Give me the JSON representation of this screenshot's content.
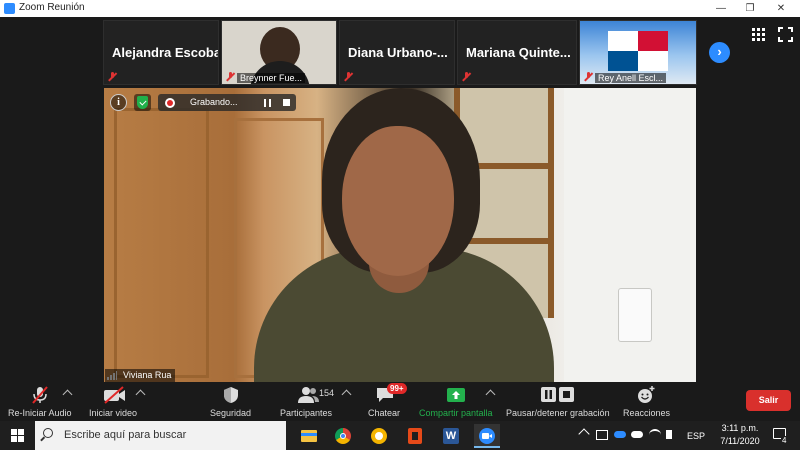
{
  "window": {
    "title": "Zoom Reunión",
    "controls": [
      "—",
      "❐",
      "✕"
    ]
  },
  "gallery": {
    "tiles": [
      {
        "name": "Alejandra Escobar",
        "type": "name"
      },
      {
        "name": "Breynner Fue...",
        "type": "video"
      },
      {
        "name": "Diana Urbano-...",
        "type": "name"
      },
      {
        "name": "Mariana Quinte...",
        "type": "name"
      },
      {
        "name": "Rey Anell Escl...",
        "type": "video"
      }
    ],
    "next_icon": "chevron-right-icon"
  },
  "meeting": {
    "recording_label": "Grabando...",
    "speaker_name": "Viviana Rua"
  },
  "toolbar": {
    "audio_label": "Re-Iniciar Audio",
    "video_label": "Iniciar video",
    "security_label": "Seguridad",
    "participants_label": "Participantes",
    "participants_count": "154",
    "chat_label": "Chatear",
    "chat_badge": "99+",
    "share_label": "Compartir pantalla",
    "record_label": "Pausar/detener grabación",
    "reactions_label": "Reacciones",
    "leave_label": "Salir",
    "share_color": "#23b14d",
    "leave_color": "#d9302c"
  },
  "taskbar": {
    "search_placeholder": "Escribe aquí para buscar",
    "language": "ESP",
    "time": "3:11 p.m.",
    "date": "7/11/2020",
    "notifications": "4"
  }
}
